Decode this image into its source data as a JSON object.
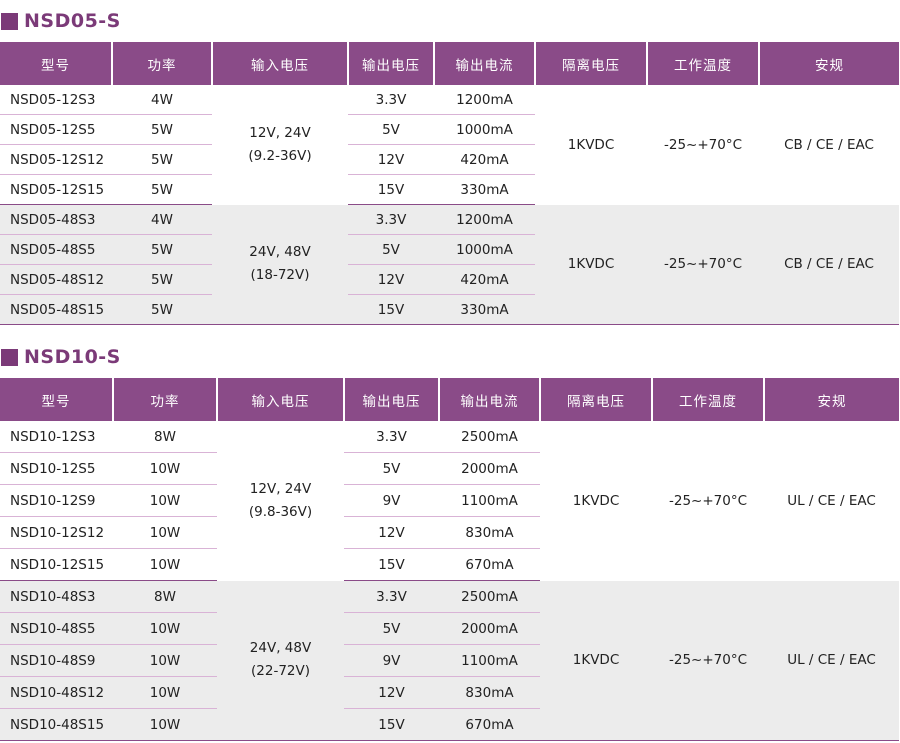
{
  "headers": [
    "型号",
    "功率",
    "输入电压",
    "输出电压",
    "输出电流",
    "隔离电压",
    "工作温度",
    "安规"
  ],
  "sections": [
    {
      "title": "NSD05-S",
      "groups": [
        {
          "input_voltage": [
            "12V, 24V",
            "(9.2-36V)"
          ],
          "isolation": "1KVDC",
          "temperature": "-25~+70°C",
          "safety": "CB / CE / EAC",
          "rows": [
            {
              "model": "NSD05-12S3",
              "power": "4W",
              "vout": "3.3V",
              "iout": "1200mA"
            },
            {
              "model": "NSD05-12S5",
              "power": "5W",
              "vout": "5V",
              "iout": "1000mA"
            },
            {
              "model": "NSD05-12S12",
              "power": "5W",
              "vout": "12V",
              "iout": "420mA"
            },
            {
              "model": "NSD05-12S15",
              "power": "5W",
              "vout": "15V",
              "iout": "330mA"
            }
          ]
        },
        {
          "input_voltage": [
            "24V, 48V",
            "(18-72V)"
          ],
          "isolation": "1KVDC",
          "temperature": "-25~+70°C",
          "safety": "CB / CE / EAC",
          "rows": [
            {
              "model": "NSD05-48S3",
              "power": "4W",
              "vout": "3.3V",
              "iout": "1200mA"
            },
            {
              "model": "NSD05-48S5",
              "power": "5W",
              "vout": "5V",
              "iout": "1000mA"
            },
            {
              "model": "NSD05-48S12",
              "power": "5W",
              "vout": "12V",
              "iout": "420mA"
            },
            {
              "model": "NSD05-48S15",
              "power": "5W",
              "vout": "15V",
              "iout": "330mA"
            }
          ]
        }
      ]
    },
    {
      "title": "NSD10-S",
      "groups": [
        {
          "input_voltage": [
            "12V, 24V",
            "(9.8-36V)"
          ],
          "isolation": "1KVDC",
          "temperature": "-25~+70°C",
          "safety": "UL / CE / EAC",
          "rows": [
            {
              "model": "NSD10-12S3",
              "power": "8W",
              "vout": "3.3V",
              "iout": "2500mA"
            },
            {
              "model": "NSD10-12S5",
              "power": "10W",
              "vout": "5V",
              "iout": "2000mA"
            },
            {
              "model": "NSD10-12S9",
              "power": "10W",
              "vout": "9V",
              "iout": "1100mA"
            },
            {
              "model": "NSD10-12S12",
              "power": "10W",
              "vout": "12V",
              "iout": "830mA"
            },
            {
              "model": "NSD10-12S15",
              "power": "10W",
              "vout": "15V",
              "iout": "670mA"
            }
          ]
        },
        {
          "input_voltage": [
            "24V, 48V",
            "(22-72V)"
          ],
          "isolation": "1KVDC",
          "temperature": "-25~+70°C",
          "safety": "UL / CE / EAC",
          "rows": [
            {
              "model": "NSD10-48S3",
              "power": "8W",
              "vout": "3.3V",
              "iout": "2500mA"
            },
            {
              "model": "NSD10-48S5",
              "power": "10W",
              "vout": "5V",
              "iout": "2000mA"
            },
            {
              "model": "NSD10-48S9",
              "power": "10W",
              "vout": "9V",
              "iout": "1100mA"
            },
            {
              "model": "NSD10-48S12",
              "power": "10W",
              "vout": "12V",
              "iout": "830mA"
            },
            {
              "model": "NSD10-48S15",
              "power": "10W",
              "vout": "15V",
              "iout": "670mA"
            }
          ]
        }
      ]
    }
  ]
}
